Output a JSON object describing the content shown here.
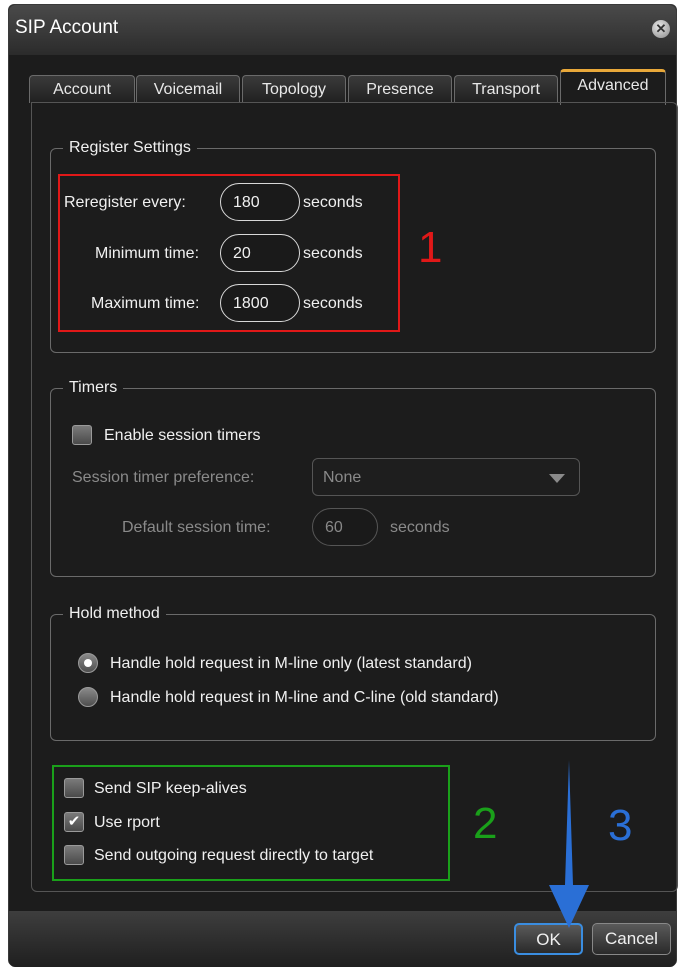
{
  "window": {
    "title": "SIP Account",
    "close_icon": "close-icon"
  },
  "tabs": [
    {
      "label": "Account"
    },
    {
      "label": "Voicemail"
    },
    {
      "label": "Topology"
    },
    {
      "label": "Presence"
    },
    {
      "label": "Transport"
    },
    {
      "label": "Advanced",
      "active": true
    }
  ],
  "register": {
    "legend": "Register Settings",
    "reregister_label": "Reregister every:",
    "reregister_value": "180",
    "minimum_label": "Minimum time:",
    "minimum_value": "20",
    "maximum_label": "Maximum time:",
    "maximum_value": "1800",
    "unit": "seconds"
  },
  "timers": {
    "legend": "Timers",
    "enable_label": "Enable session timers",
    "enable_checked": false,
    "preference_label": "Session timer preference:",
    "preference_value": "None",
    "default_label": "Default session time:",
    "default_value": "60",
    "unit": "seconds"
  },
  "hold": {
    "legend": "Hold method",
    "option1": "Handle hold request in M-line only (latest standard)",
    "option2": "Handle hold request in M-line and C-line (old standard)",
    "selected": 1
  },
  "misc": {
    "keepalive_label": "Send SIP keep-alives",
    "keepalive_checked": false,
    "rport_label": "Use rport",
    "rport_checked": true,
    "direct_label": "Send outgoing request directly to target",
    "direct_checked": false
  },
  "annotations": {
    "n1": "1",
    "n1_color": "#e01818",
    "n2": "2",
    "n2_color": "#1aa01a",
    "n3": "3",
    "n3_color": "#2a6fd6"
  },
  "footer": {
    "ok_label": "OK",
    "cancel_label": "Cancel"
  }
}
